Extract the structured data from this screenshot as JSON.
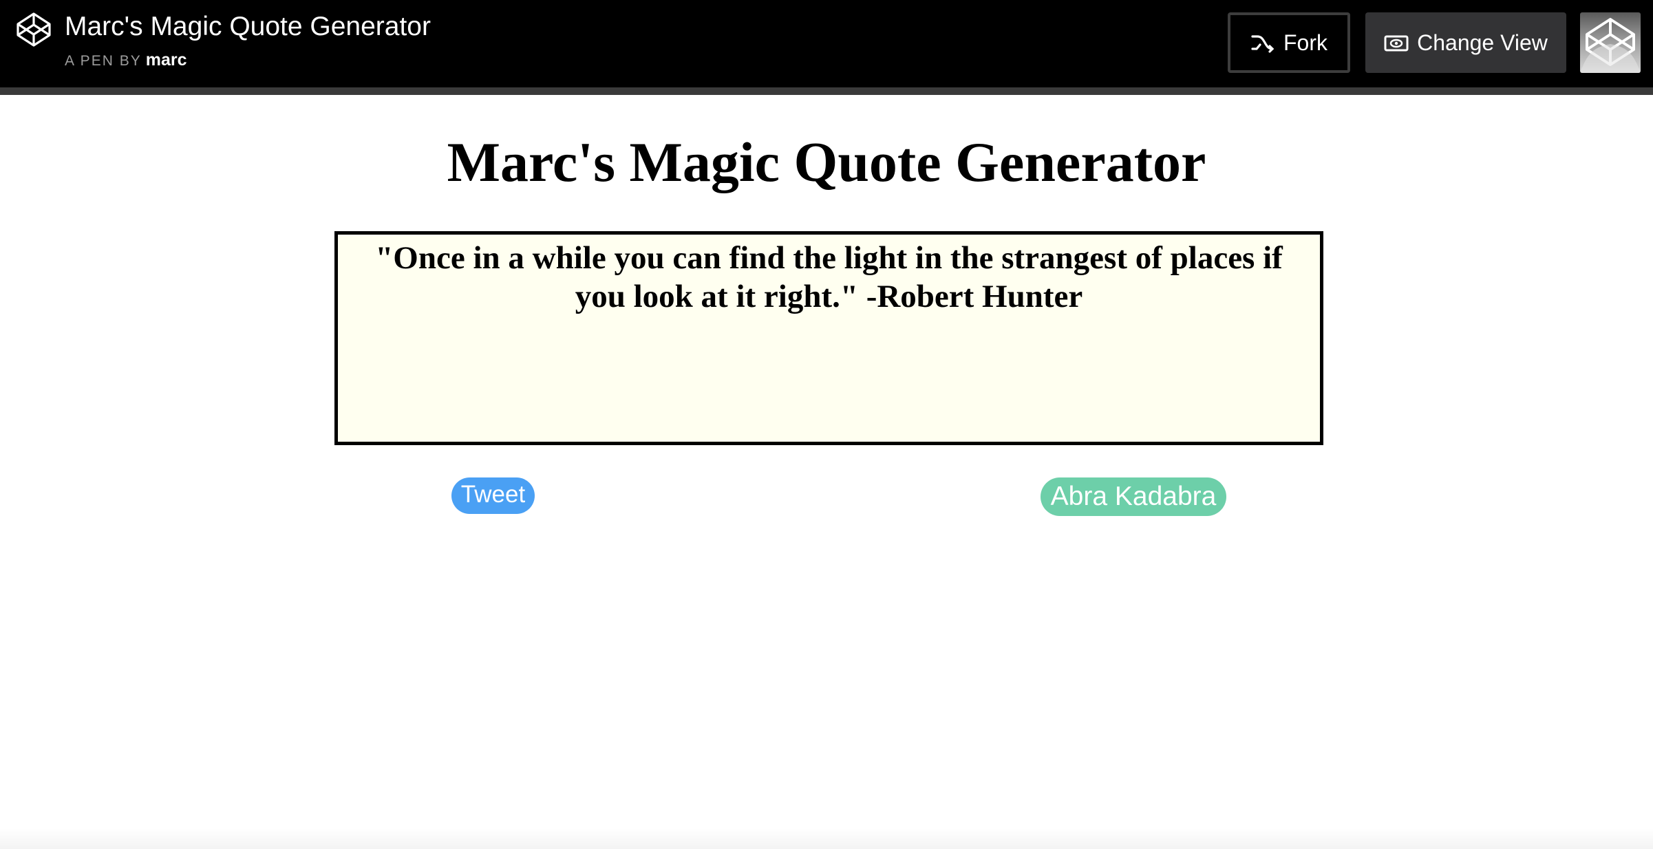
{
  "header": {
    "pen_title": "Marc's Magic Quote Generator",
    "byline_prefix": "A PEN BY",
    "author": "marc",
    "fork_label": "Fork",
    "change_view_label": "Change View",
    "logo_icon": "codepen-logo-icon",
    "background_color": "#000000"
  },
  "main": {
    "heading": "Marc's Magic Quote Generator",
    "quote": "\"Once in a while you can find the light in the strangest of places if you look at it right.\" -Robert Hunter",
    "quote_box_background": "#fffff0",
    "tweet_label": "Tweet",
    "tweet_color": "#4aa0f4",
    "new_quote_label": "Abra Kadabra",
    "new_quote_color": "#6dcfa9"
  }
}
